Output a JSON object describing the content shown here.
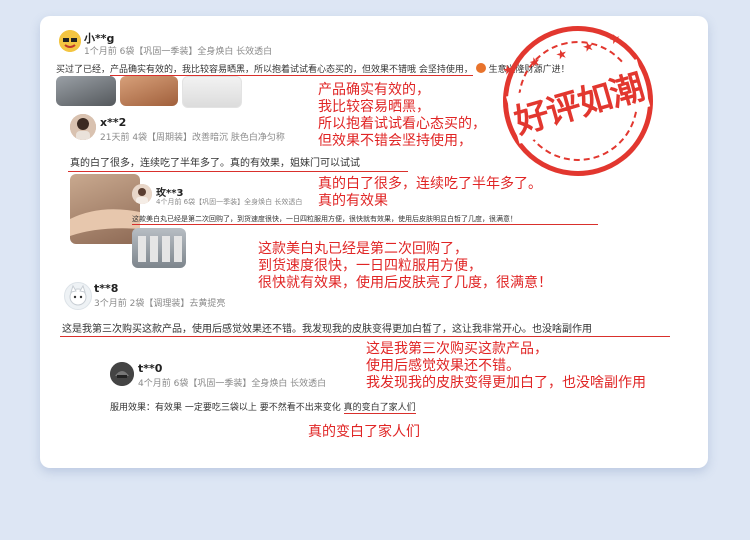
{
  "reviews": [
    {
      "name": "小**g",
      "meta": "1个月前 6袋【巩固一季装】全身焕白 长效透白",
      "text_a": "买过了已经，",
      "text_b": "产品确实有效的，我比较容易晒黑，所以抱着试试看心态买的，但效果不错哦 会坚持使用，",
      "text_c": "生意兴隆财源广进！"
    },
    {
      "name": "x**2",
      "meta": "21天前 4袋【周期装】改善暗沉 肤色白净匀称",
      "text": "真的白了很多，连续吃了半年多了。真的有效果，姐妹门可以试试"
    },
    {
      "name": "玫**3",
      "meta": "4个月前 6袋【巩固一季装】全身焕白 长效透白",
      "text": "这款美白丸已经是第二次回购了，到货速度很快，一日四粒服用方便，很快就有效果，使用后皮肤明显白皙了几度，很满意！"
    },
    {
      "name": "t**8",
      "meta": "3个月前 2袋【调理装】去黄提亮",
      "text": "这是我第三次购买这款产品，使用后感觉效果还不错。我发现我的皮肤变得更加白皙了，这让我非常开心。也没啥副作用"
    },
    {
      "name": "t**0",
      "meta": "4个月前 6袋【巩固一季装】全身焕白 长效透白",
      "text_a": "服用效果：有效果 一定要吃三袋以上 要不然看不出来变化",
      "text_b": "真的变白了家人们"
    }
  ],
  "annotations": {
    "a1": [
      "产品确实有效的，",
      "我比较容易晒黑，",
      "所以抱着试试看心态买的，",
      "但效果不错会坚持使用，"
    ],
    "a2": [
      "真的白了很多，连续吃了半年多了。",
      "真的有效果"
    ],
    "a3": [
      "这款美白丸已经是第二次回购了，",
      "到货速度很快，一日四粒服用方便，",
      "很快就有效果，使用后皮肤亮了几度，很满意！"
    ],
    "a4": [
      "这是我第三次购买这款产品，",
      "使用后感觉效果还不错。",
      "我发现我的皮肤变得更加白了，也没啥副作用"
    ],
    "a5": [
      "真的变白了家人们"
    ]
  },
  "stamp": {
    "text": "好评如潮",
    "stars": "★ ★ ★ ★ ★",
    "color": "#e2372f"
  },
  "colors": {
    "annotation": "#e02525",
    "background": "#dde6f4",
    "card": "#ffffff"
  }
}
